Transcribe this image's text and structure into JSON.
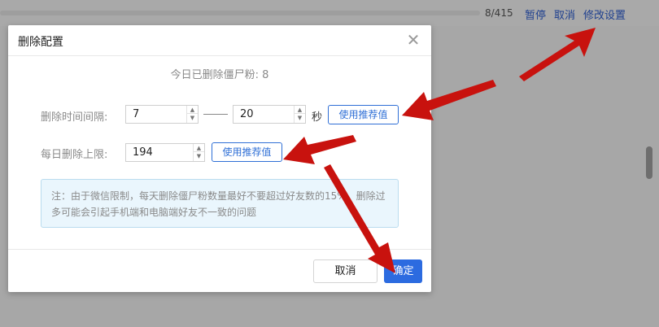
{
  "background": {
    "progress_text": "8/415",
    "links": {
      "pause": "暂停",
      "cancel": "取消",
      "modify": "修改设置"
    }
  },
  "dialog": {
    "title": "删除配置",
    "summary": "今日已删除僵尸粉: 8",
    "interval": {
      "label": "删除时间间隔:",
      "min": "7",
      "max": "20",
      "unit": "秒",
      "recommend_label": "使用推荐值"
    },
    "daily_limit": {
      "label": "每日删除上限:",
      "value": "194",
      "recommend_label": "使用推荐值"
    },
    "notice": "注：由于微信限制，每天删除僵尸粉数量最好不要超过好友数的15%，删除过多可能会引起手机端和电脑端好友不一致的问题",
    "buttons": {
      "cancel": "取消",
      "ok": "确定"
    }
  },
  "colors": {
    "primary": "#2c6be0",
    "link": "#2f6fd6",
    "arrow": "#c8120e",
    "notice_bg": "#eaf6fd"
  }
}
